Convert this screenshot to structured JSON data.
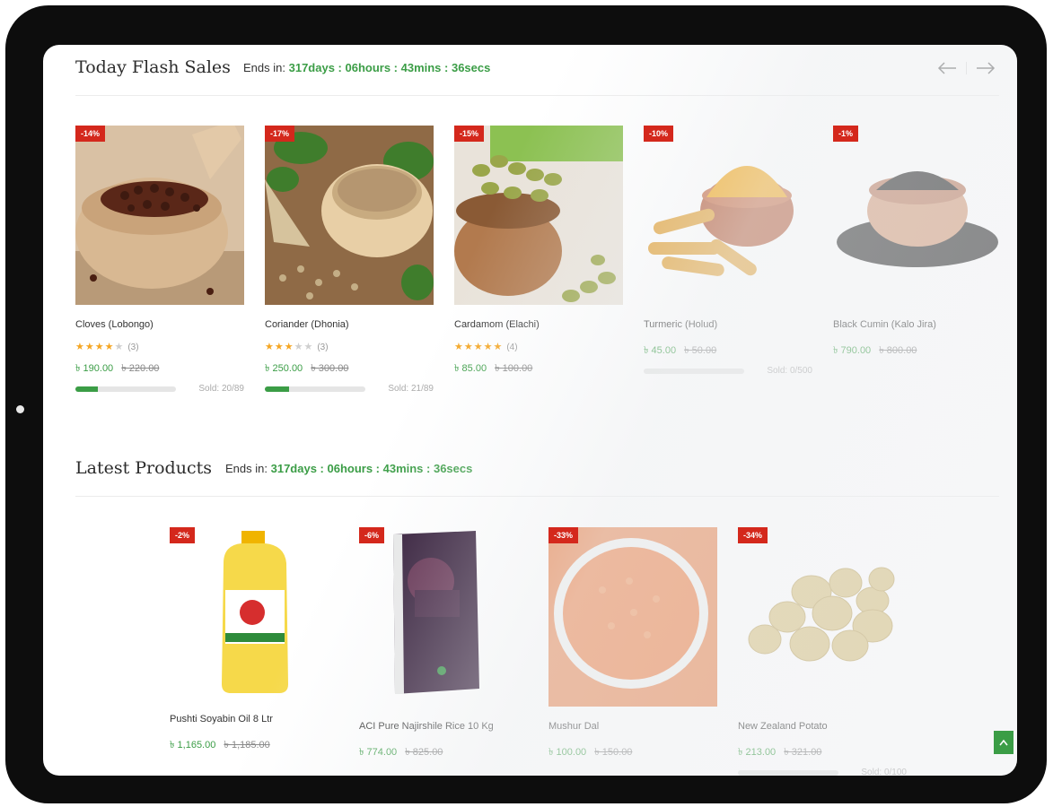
{
  "flash": {
    "title": "Today Flash Sales",
    "ends_label": "Ends in:",
    "ends_value": "317days : 06hours : 43mins : 36secs",
    "products": [
      {
        "name": "Cloves (Lobongo)",
        "discount": "-14%",
        "rating": 4,
        "reviews": "(3)",
        "price": "৳ 190.00",
        "old_price": "৳ 220.00",
        "sold": "Sold: 20/89",
        "progress": 0.22
      },
      {
        "name": "Coriander (Dhonia)",
        "discount": "-17%",
        "rating": 3,
        "reviews": "(3)",
        "price": "৳ 250.00",
        "old_price": "৳ 300.00",
        "sold": "Sold: 21/89",
        "progress": 0.24
      },
      {
        "name": "Cardamom (Elachi)",
        "discount": "-15%",
        "rating": 5,
        "reviews": "(4)",
        "price": "৳ 85.00",
        "old_price": "৳ 100.00",
        "sold": "",
        "progress": null
      },
      {
        "name": "Turmeric (Holud)",
        "discount": "-10%",
        "rating": 0,
        "reviews": "",
        "price": "৳ 45.00",
        "old_price": "৳ 50.00",
        "sold": "Sold: 0/500",
        "progress": 0
      },
      {
        "name": "Black Cumin (Kalo Jira)",
        "discount": "-1%",
        "rating": 0,
        "reviews": "",
        "price": "৳ 790.00",
        "old_price": "৳ 800.00",
        "sold": "",
        "progress": null
      }
    ]
  },
  "latest": {
    "title": "Latest Products",
    "ends_label": "Ends in:",
    "ends_value": "317days : 06hours : 43mins : 36secs",
    "products": [
      {
        "name": "Pushti Soyabin Oil 8 Ltr",
        "discount": "-2%",
        "price": "৳ 1,165.00",
        "old_price": "৳ 1,185.00",
        "sold": "",
        "progress": null
      },
      {
        "name": "ACI Pure Najirshile Rice 10 Kg",
        "discount": "-6%",
        "price": "৳ 774.00",
        "old_price": "৳ 825.00",
        "sold": "",
        "progress": null
      },
      {
        "name": "Mushur Dal",
        "discount": "-33%",
        "price": "৳ 100.00",
        "old_price": "৳ 150.00",
        "sold": "",
        "progress": null
      },
      {
        "name": "New Zealand Potato",
        "discount": "-34%",
        "price": "৳ 213.00",
        "old_price": "৳ 321.00",
        "sold": "Sold: 0/100",
        "progress": 0
      }
    ]
  },
  "icons": {
    "prev": "arrow-left-icon",
    "next": "arrow-right-icon",
    "scroll_top": "chevron-up-icon",
    "star": "star-icon"
  },
  "colors": {
    "accent": "#3b9d46",
    "badge": "#d4281c",
    "star": "#f5a623",
    "device": "#0d0d0d"
  }
}
